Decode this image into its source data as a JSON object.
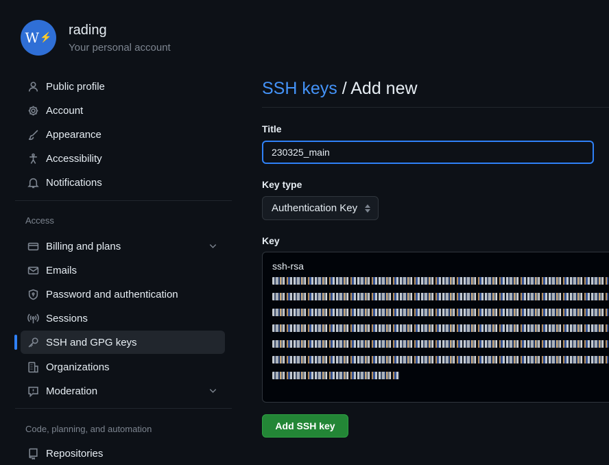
{
  "account": {
    "avatar_text": "W",
    "name": "rading",
    "subtitle": "Your personal account"
  },
  "nav": {
    "items": [
      {
        "label": "Public profile"
      },
      {
        "label": "Account"
      },
      {
        "label": "Appearance"
      },
      {
        "label": "Accessibility"
      },
      {
        "label": "Notifications"
      }
    ],
    "access_label": "Access",
    "access_items": [
      {
        "label": "Billing and plans"
      },
      {
        "label": "Emails"
      },
      {
        "label": "Password and authentication"
      },
      {
        "label": "Sessions"
      },
      {
        "label": "SSH and GPG keys",
        "active": true
      },
      {
        "label": "Organizations"
      },
      {
        "label": "Moderation"
      }
    ],
    "code_label": "Code, planning, and automation",
    "code_items": [
      {
        "label": "Repositories"
      }
    ]
  },
  "main": {
    "breadcrumb_link": "SSH keys",
    "breadcrumb_sep": "/",
    "breadcrumb_current": "Add new",
    "title_label": "Title",
    "title_value": "230325_main",
    "key_type_label": "Key type",
    "key_type_value": "Authentication Key",
    "key_label": "Key",
    "key_prefix": "ssh-rsa",
    "submit_label": "Add SSH key"
  },
  "colors": {
    "accent": "#2f81f7",
    "link": "#4493f8",
    "primary_button": "#238636"
  }
}
